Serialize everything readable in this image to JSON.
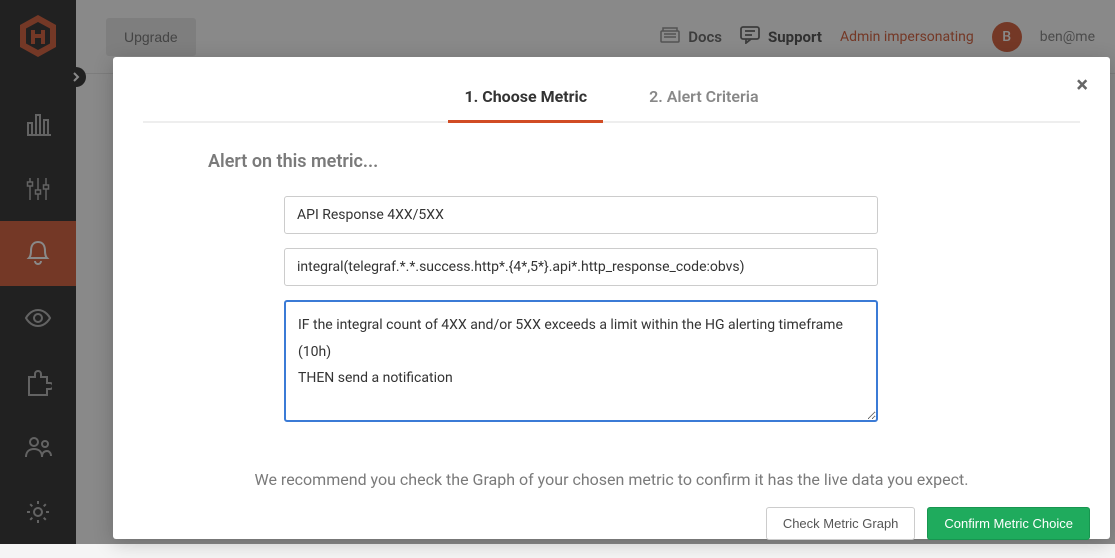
{
  "topbar": {
    "upgrade": "Upgrade",
    "docs": "Docs",
    "support": "Support",
    "impersonating": "Admin impersonating",
    "avatar_initial": "B",
    "user_email": "ben@me"
  },
  "sidebar": {
    "items": [
      {
        "name": "logo"
      },
      {
        "name": "dashboards"
      },
      {
        "name": "metrics"
      },
      {
        "name": "alerts",
        "active": true
      },
      {
        "name": "views"
      },
      {
        "name": "integrations"
      },
      {
        "name": "team"
      },
      {
        "name": "settings"
      }
    ]
  },
  "modal": {
    "tabs": {
      "choose_metric": "1. Choose Metric",
      "alert_criteria": "2. Alert Criteria"
    },
    "subtitle": "Alert on this metric...",
    "metric_name": "API Response 4XX/5XX",
    "metric_query": "integral(telegraf.*.*.success.http*.{4*,5*}.api*.http_response_code:obvs)",
    "description": "IF the integral count of 4XX and/or 5XX exceeds a limit within the HG alerting timeframe (10h)\nTHEN send a notification",
    "recommend": "We recommend you check the Graph of your chosen metric to confirm it has the live data you expect.",
    "buttons": {
      "check_graph": "Check Metric Graph",
      "confirm": "Confirm Metric Choice"
    }
  }
}
